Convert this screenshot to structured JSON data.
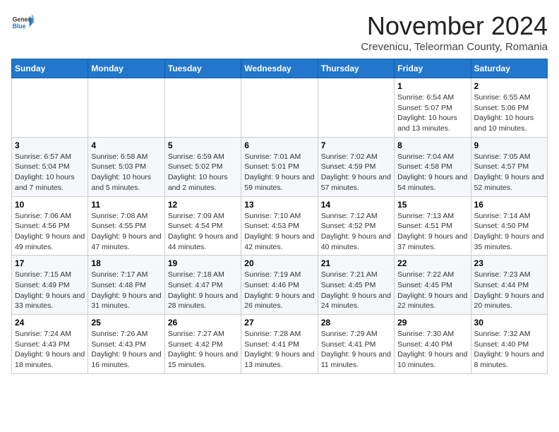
{
  "header": {
    "logo_general": "General",
    "logo_blue": "Blue",
    "month_title": "November 2024",
    "subtitle": "Crevenicu, Teleorman County, Romania"
  },
  "weekdays": [
    "Sunday",
    "Monday",
    "Tuesday",
    "Wednesday",
    "Thursday",
    "Friday",
    "Saturday"
  ],
  "weeks": [
    [
      {
        "day": "",
        "info": ""
      },
      {
        "day": "",
        "info": ""
      },
      {
        "day": "",
        "info": ""
      },
      {
        "day": "",
        "info": ""
      },
      {
        "day": "",
        "info": ""
      },
      {
        "day": "1",
        "info": "Sunrise: 6:54 AM\nSunset: 5:07 PM\nDaylight: 10 hours and 13 minutes."
      },
      {
        "day": "2",
        "info": "Sunrise: 6:55 AM\nSunset: 5:06 PM\nDaylight: 10 hours and 10 minutes."
      }
    ],
    [
      {
        "day": "3",
        "info": "Sunrise: 6:57 AM\nSunset: 5:04 PM\nDaylight: 10 hours and 7 minutes."
      },
      {
        "day": "4",
        "info": "Sunrise: 6:58 AM\nSunset: 5:03 PM\nDaylight: 10 hours and 5 minutes."
      },
      {
        "day": "5",
        "info": "Sunrise: 6:59 AM\nSunset: 5:02 PM\nDaylight: 10 hours and 2 minutes."
      },
      {
        "day": "6",
        "info": "Sunrise: 7:01 AM\nSunset: 5:01 PM\nDaylight: 9 hours and 59 minutes."
      },
      {
        "day": "7",
        "info": "Sunrise: 7:02 AM\nSunset: 4:59 PM\nDaylight: 9 hours and 57 minutes."
      },
      {
        "day": "8",
        "info": "Sunrise: 7:04 AM\nSunset: 4:58 PM\nDaylight: 9 hours and 54 minutes."
      },
      {
        "day": "9",
        "info": "Sunrise: 7:05 AM\nSunset: 4:57 PM\nDaylight: 9 hours and 52 minutes."
      }
    ],
    [
      {
        "day": "10",
        "info": "Sunrise: 7:06 AM\nSunset: 4:56 PM\nDaylight: 9 hours and 49 minutes."
      },
      {
        "day": "11",
        "info": "Sunrise: 7:08 AM\nSunset: 4:55 PM\nDaylight: 9 hours and 47 minutes."
      },
      {
        "day": "12",
        "info": "Sunrise: 7:09 AM\nSunset: 4:54 PM\nDaylight: 9 hours and 44 minutes."
      },
      {
        "day": "13",
        "info": "Sunrise: 7:10 AM\nSunset: 4:53 PM\nDaylight: 9 hours and 42 minutes."
      },
      {
        "day": "14",
        "info": "Sunrise: 7:12 AM\nSunset: 4:52 PM\nDaylight: 9 hours and 40 minutes."
      },
      {
        "day": "15",
        "info": "Sunrise: 7:13 AM\nSunset: 4:51 PM\nDaylight: 9 hours and 37 minutes."
      },
      {
        "day": "16",
        "info": "Sunrise: 7:14 AM\nSunset: 4:50 PM\nDaylight: 9 hours and 35 minutes."
      }
    ],
    [
      {
        "day": "17",
        "info": "Sunrise: 7:15 AM\nSunset: 4:49 PM\nDaylight: 9 hours and 33 minutes."
      },
      {
        "day": "18",
        "info": "Sunrise: 7:17 AM\nSunset: 4:48 PM\nDaylight: 9 hours and 31 minutes."
      },
      {
        "day": "19",
        "info": "Sunrise: 7:18 AM\nSunset: 4:47 PM\nDaylight: 9 hours and 28 minutes."
      },
      {
        "day": "20",
        "info": "Sunrise: 7:19 AM\nSunset: 4:46 PM\nDaylight: 9 hours and 26 minutes."
      },
      {
        "day": "21",
        "info": "Sunrise: 7:21 AM\nSunset: 4:45 PM\nDaylight: 9 hours and 24 minutes."
      },
      {
        "day": "22",
        "info": "Sunrise: 7:22 AM\nSunset: 4:45 PM\nDaylight: 9 hours and 22 minutes."
      },
      {
        "day": "23",
        "info": "Sunrise: 7:23 AM\nSunset: 4:44 PM\nDaylight: 9 hours and 20 minutes."
      }
    ],
    [
      {
        "day": "24",
        "info": "Sunrise: 7:24 AM\nSunset: 4:43 PM\nDaylight: 9 hours and 18 minutes."
      },
      {
        "day": "25",
        "info": "Sunrise: 7:26 AM\nSunset: 4:43 PM\nDaylight: 9 hours and 16 minutes."
      },
      {
        "day": "26",
        "info": "Sunrise: 7:27 AM\nSunset: 4:42 PM\nDaylight: 9 hours and 15 minutes."
      },
      {
        "day": "27",
        "info": "Sunrise: 7:28 AM\nSunset: 4:41 PM\nDaylight: 9 hours and 13 minutes."
      },
      {
        "day": "28",
        "info": "Sunrise: 7:29 AM\nSunset: 4:41 PM\nDaylight: 9 hours and 11 minutes."
      },
      {
        "day": "29",
        "info": "Sunrise: 7:30 AM\nSunset: 4:40 PM\nDaylight: 9 hours and 10 minutes."
      },
      {
        "day": "30",
        "info": "Sunrise: 7:32 AM\nSunset: 4:40 PM\nDaylight: 9 hours and 8 minutes."
      }
    ]
  ]
}
